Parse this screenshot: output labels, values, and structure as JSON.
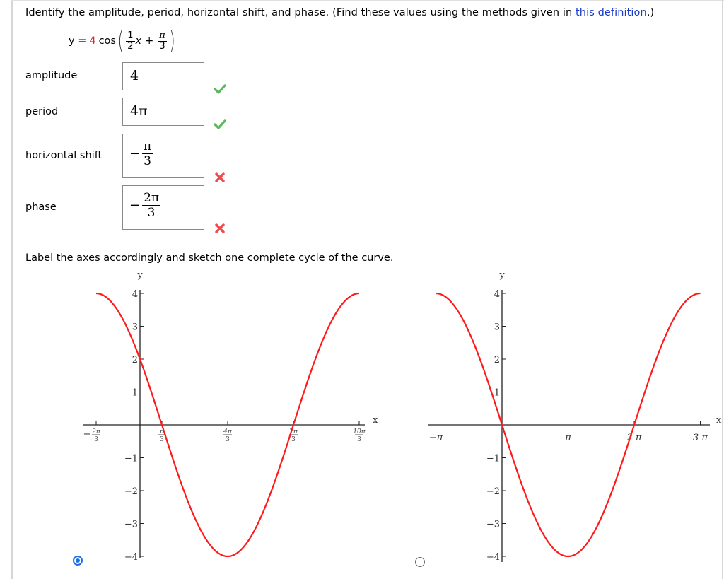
{
  "question": {
    "prompt_prefix": "Identify the amplitude, period, horizontal shift, and phase. (Find these values using the methods given in ",
    "prompt_link": "this definition",
    "prompt_suffix": ".)",
    "equation": {
      "lhs": "y =",
      "amplitude": "4",
      "func": "cos",
      "coef_num": "1",
      "coef_den": "2",
      "var": "x",
      "plus": "+",
      "shift_num": "π",
      "shift_den": "3"
    }
  },
  "answers": [
    {
      "label": "amplitude",
      "value": "4",
      "status": "correct"
    },
    {
      "label": "period",
      "value": "4π",
      "status": "correct"
    },
    {
      "label": "horizontal shift",
      "sign": "−",
      "num": "π",
      "den": "3",
      "status": "incorrect"
    },
    {
      "label": "phase",
      "sign": "−",
      "num": "2π",
      "den": "3",
      "status": "incorrect"
    }
  ],
  "instruction": "Label the axes accordingly and sketch one complete cycle of the curve.",
  "colors": {
    "curve": "#ff1a1a",
    "correct": "#5cb85c",
    "incorrect": "#ee4b4b",
    "link": "#1a3cc8",
    "radio_selected": "#1e6fe8"
  },
  "chart_data": [
    {
      "type": "line",
      "name": "option-1",
      "selected": true,
      "function": "4cos(x/2 + π/3)",
      "xlabel": "x",
      "ylabel": "y",
      "x_unit": "π/3",
      "xlim_units": [
        -2,
        10
      ],
      "ylim": [
        -4,
        4
      ],
      "x_ticks": [
        {
          "units": -2,
          "sign": "−",
          "num": "2π",
          "den": "3"
        },
        {
          "units": 1,
          "sign": "",
          "num": "π",
          "den": "3"
        },
        {
          "units": 4,
          "sign": "",
          "num": "4π",
          "den": "3"
        },
        {
          "units": 7,
          "sign": "",
          "num": "7π",
          "den": "3"
        },
        {
          "units": 10,
          "sign": "",
          "num": "10π",
          "den": "3"
        }
      ],
      "y_ticks": [
        "4",
        "3",
        "2",
        "1",
        "−1",
        "−2",
        "−3",
        "−4"
      ],
      "y_tick_values": [
        4,
        3,
        2,
        1,
        -1,
        -2,
        -3,
        -4
      ],
      "key_points": [
        {
          "x": "-2π/3",
          "y": 4
        },
        {
          "x": "π/3",
          "y": 0
        },
        {
          "x": "4π/3",
          "y": -4
        },
        {
          "x": "7π/3",
          "y": 0
        },
        {
          "x": "10π/3",
          "y": 4
        }
      ]
    },
    {
      "type": "line",
      "name": "option-2",
      "selected": false,
      "function": "4cos(x/2 + π/2)",
      "xlabel": "x",
      "ylabel": "y",
      "x_unit": "π",
      "xlim_units": [
        -1,
        3
      ],
      "ylim": [
        -4,
        4
      ],
      "x_ticks": [
        {
          "units": -1,
          "label": "−π"
        },
        {
          "units": 1,
          "label": "π"
        },
        {
          "units": 2,
          "label": "2 π"
        },
        {
          "units": 3,
          "label": "3 π"
        }
      ],
      "y_ticks": [
        "4",
        "3",
        "2",
        "1",
        "−1",
        "−2",
        "−3",
        "−4"
      ],
      "y_tick_values": [
        4,
        3,
        2,
        1,
        -1,
        -2,
        -3,
        -4
      ],
      "key_points": [
        {
          "x": "-π",
          "y": 4
        },
        {
          "x": "0",
          "y": 0
        },
        {
          "x": "π",
          "y": -4
        },
        {
          "x": "2π",
          "y": 0
        },
        {
          "x": "3π",
          "y": 4
        }
      ]
    }
  ]
}
